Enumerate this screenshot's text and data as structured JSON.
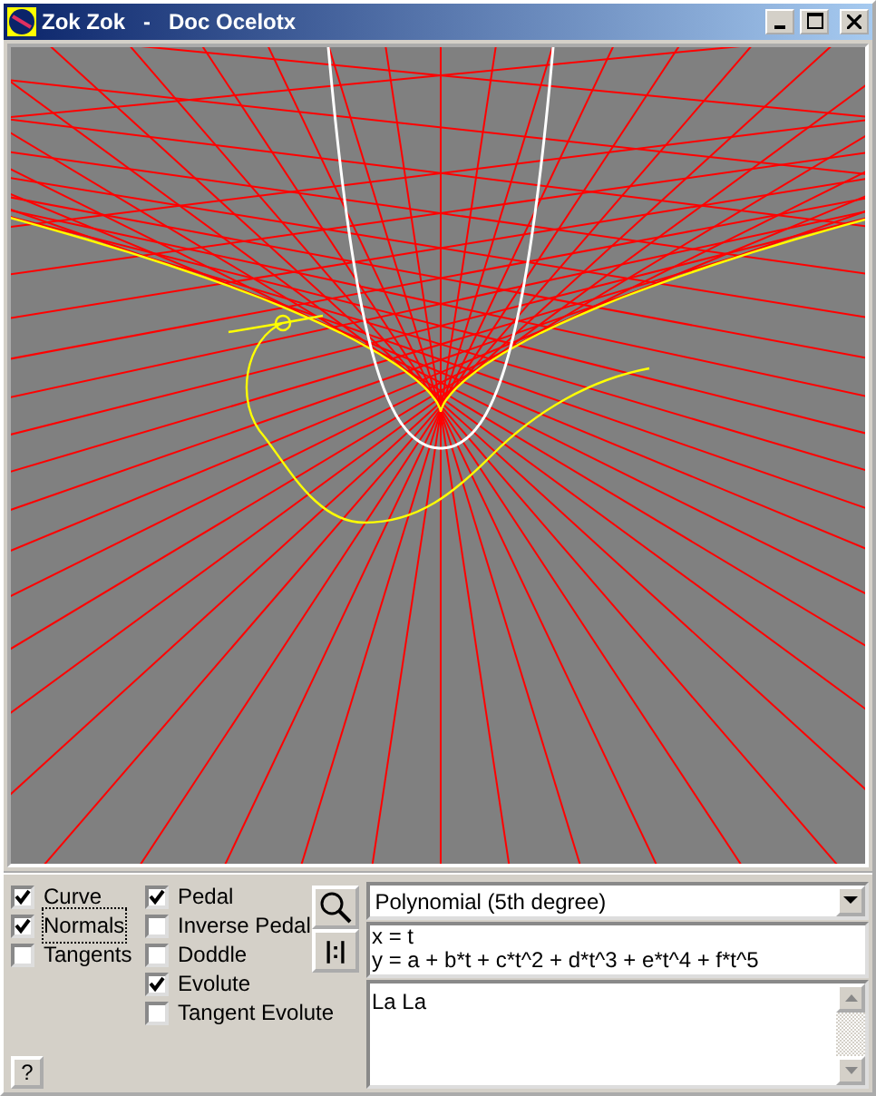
{
  "window": {
    "title": "Zok Zok   -   Doc Ocelotx"
  },
  "curve_options": [
    {
      "label": "Curve",
      "checked": true,
      "focused": false
    },
    {
      "label": "Normals",
      "checked": true,
      "focused": true
    },
    {
      "label": "Tangents",
      "checked": false,
      "focused": false
    }
  ],
  "derived_options": [
    {
      "label": "Pedal",
      "checked": true,
      "focused": false
    },
    {
      "label": "Inverse Pedal",
      "checked": false,
      "focused": false
    },
    {
      "label": "Doddle",
      "checked": false,
      "focused": false
    },
    {
      "label": "Evolute",
      "checked": true,
      "focused": false
    },
    {
      "label": "Tangent Evolute",
      "checked": false,
      "focused": false
    }
  ],
  "fit_button": {
    "label": "|:|"
  },
  "help_button": {
    "label": "?"
  },
  "curve_type": {
    "value": "Polynomial (5th degree)"
  },
  "formula": [
    "x = t",
    "y = a + b*t + c*t^2 + d*t^3 + e*t^4 + f*t^5"
  ],
  "notes": {
    "value": "La La"
  }
}
